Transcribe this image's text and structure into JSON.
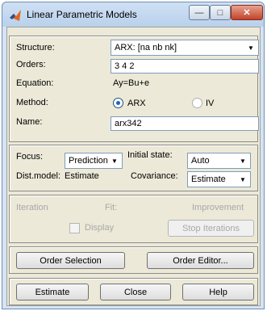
{
  "window": {
    "title": "Linear Parametric Models",
    "min_symbol": "—",
    "max_symbol": "□",
    "close_symbol": "✕"
  },
  "model": {
    "structure_label": "Structure:",
    "structure_value": "ARX: [na nb nk]",
    "orders_label": "Orders:",
    "orders_value": "3 4 2",
    "equation_label": "Equation:",
    "equation_value": "Ay=Bu+e",
    "method_label": "Method:",
    "method_arx": "ARX",
    "method_iv": "IV",
    "method_selected": "ARX",
    "name_label": "Name:",
    "name_value": "arx342"
  },
  "options": {
    "focus_label": "Focus:",
    "focus_value": "Prediction",
    "initial_state_label": "Initial state:",
    "initial_state_value": "Auto",
    "dist_model_label": "Dist.model:",
    "dist_model_value": "Estimate",
    "covariance_label": "Covariance:",
    "covariance_value": "Estimate"
  },
  "progress": {
    "iteration_label": "Iteration",
    "fit_label": "Fit:",
    "improvement_label": "Improvement",
    "display_label": "Display",
    "stop_label": "Stop Iterations"
  },
  "order_buttons": {
    "order_selection": "Order Selection",
    "order_editor": "Order Editor..."
  },
  "actions": {
    "estimate": "Estimate",
    "close": "Close",
    "help": "Help"
  }
}
